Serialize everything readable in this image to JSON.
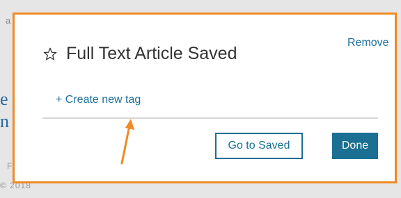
{
  "background": {
    "fragments": [
      "a",
      "e",
      "n",
      "F",
      "© 2018"
    ]
  },
  "dialog": {
    "remove_label": "Remove",
    "star_icon": "star-outline-icon",
    "title": "Full Text Article Saved",
    "create_tag_label": "+ Create new tag",
    "go_to_saved_label": "Go to Saved",
    "done_label": "Done"
  },
  "annotation": {
    "highlight_color": "#f08a24",
    "arrow_icon": "arrow-up-icon"
  },
  "colors": {
    "accent": "#1a6f93",
    "link": "#1f6f9c",
    "highlight": "#f08a24"
  }
}
